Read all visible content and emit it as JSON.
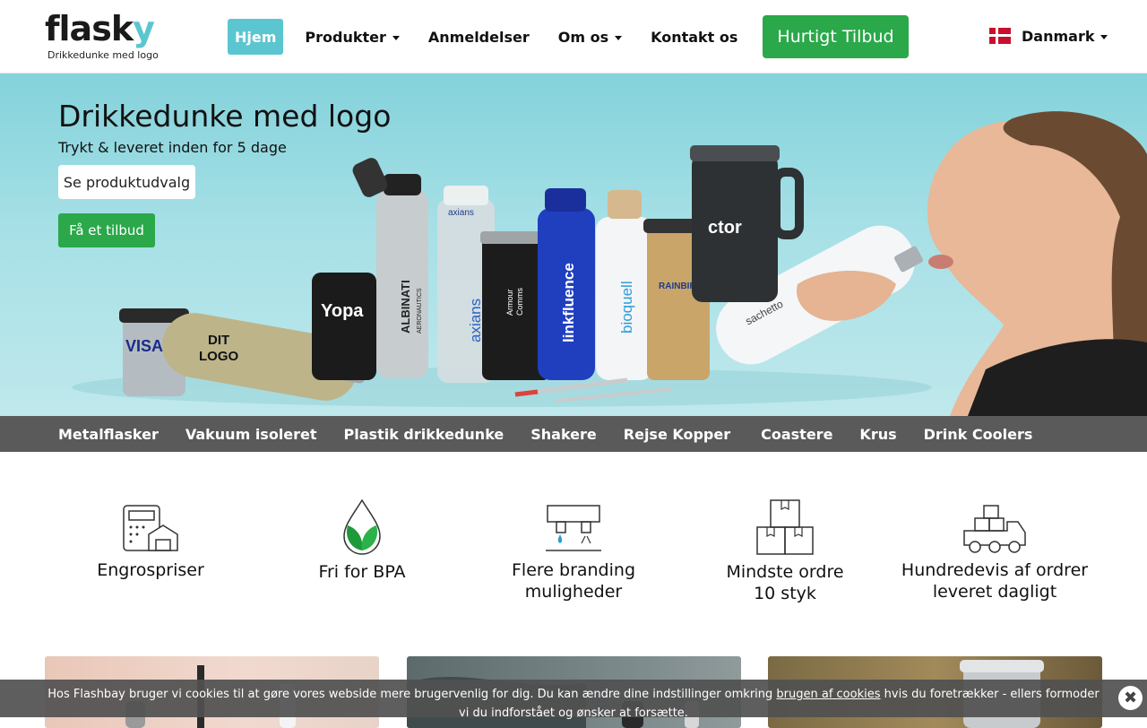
{
  "brand": {
    "name_main": "flask",
    "name_accent": "y",
    "tagline": "Drikkedunke med logo",
    "accent_color": "#5bc6d0"
  },
  "nav": {
    "items": [
      {
        "label": "Hjem",
        "active": true,
        "dropdown": false
      },
      {
        "label": "Produkter",
        "active": false,
        "dropdown": true
      },
      {
        "label": "Anmeldelser",
        "active": false,
        "dropdown": false
      },
      {
        "label": "Om os",
        "active": false,
        "dropdown": true
      },
      {
        "label": "Kontakt os",
        "active": false,
        "dropdown": false
      }
    ],
    "quote_button": "Hurtigt Tilbud",
    "language": "Danmark"
  },
  "hero": {
    "title": "Drikkedunke med logo",
    "subtitle": "Trykt & leveret inden for 5 dage",
    "primary_button": "Se produktudvalg",
    "secondary_button": "Få et tilbud",
    "product_labels": [
      "VISA",
      "DIT",
      "LOGO",
      "Yopa",
      "ALBINATI",
      "AERONAUTICS",
      "axians",
      "axians",
      "Armour",
      "Comms",
      "linkfluence",
      "bioquell",
      "RAINBIRD",
      "ctor",
      "sachetto"
    ]
  },
  "categories": [
    "Metalflasker",
    "Vakuum isoleret",
    "Plastik drikkedunke",
    "Shakere",
    "Rejse Kopper",
    "Coastere",
    "Krus",
    "Drink Coolers"
  ],
  "features": [
    {
      "line1": "Engrospriser",
      "line2": "",
      "icon": "calculator-warehouse-icon"
    },
    {
      "line1": "Fri for BPA",
      "line2": "",
      "icon": "leaf-drop-icon"
    },
    {
      "line1": "Flere branding",
      "line2": "muligheder",
      "icon": "printer-icon"
    },
    {
      "line1": "Mindste ordre",
      "line2": "10 styk",
      "icon": "boxes-icon"
    },
    {
      "line1": "Hundredevis af ordrer",
      "line2": "leveret dagligt",
      "icon": "delivery-truck-icon"
    }
  ],
  "cookie": {
    "text_before": "Hos Flashbay bruger vi cookies til at gøre vores webside mere brugervenlig for dig. Du kan ændre dine indstillinger omkring ",
    "link": "brugen af cookies",
    "text_after": " hvis du foretrækker - ellers formoder vi du indforstået og ønsker at forsætte.",
    "close": "✖"
  },
  "colors": {
    "green": "#2aa84a",
    "category_bar": "#5a5a5a",
    "hero_bg": "#9ddde3"
  }
}
